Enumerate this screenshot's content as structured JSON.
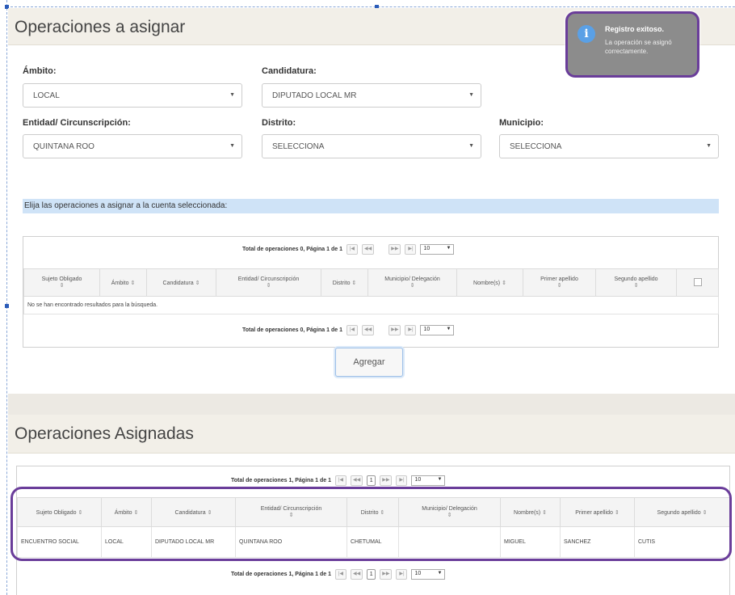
{
  "section1": {
    "title": "Operaciones a asignar"
  },
  "toast": {
    "title": "Registro exitoso.",
    "message": "La operación se asignó correctamente.",
    "icon": "info-icon"
  },
  "form": {
    "ambito": {
      "label": "Ámbito:",
      "value": "LOCAL"
    },
    "candidatura": {
      "label": "Candidatura:",
      "value": "DIPUTADO LOCAL MR"
    },
    "entidad": {
      "label": "Entidad/ Circunscripción:",
      "value": "QUINTANA ROO"
    },
    "distrito": {
      "label": "Distrito:",
      "value": "SELECCIONA"
    },
    "municipio": {
      "label": "Municipio:",
      "value": "SELECCIONA"
    }
  },
  "instructions": "Elija las operaciones a asignar a la cuenta seleccionada:",
  "table1": {
    "pager_text": "Total de operaciones 0, Página 1 de 1",
    "page_size": "10",
    "headers": [
      "Sujeto Obligado",
      "Ámbito",
      "Candidatura",
      "Entidad/ Circunscripción",
      "Distrito",
      "Municipio/ Delegación",
      "Nombre(s)",
      "Primer apellido",
      "Segundo apellido"
    ],
    "empty_message": "No se han encontrado resultados para la búsqueda."
  },
  "agregar_button": "Agregar",
  "section2": {
    "title": "Operaciones Asignadas"
  },
  "table2": {
    "pager_text": "Total de operaciones 1, Página 1 de 1",
    "current_page": "1",
    "page_size": "10",
    "headers": [
      "Sujeto Obligado",
      "Ámbito",
      "Candidatura",
      "Entidad/ Circunscripción",
      "Distrito",
      "Municipio/ Delegación",
      "Nombre(s)",
      "Primer apellido",
      "Segundo apellido"
    ],
    "rows": [
      [
        "ENCUENTRO SOCIAL",
        "LOCAL",
        "DIPUTADO LOCAL MR",
        "QUINTANA ROO",
        "CHETUMAL",
        "",
        "MIGUEL",
        "SANCHEZ",
        "CUTIS"
      ]
    ]
  },
  "colors": {
    "highlight": "#6a3d9a",
    "toast_bg": "#8c8c8c",
    "instructions_bg": "#cfe3f7",
    "header_bg": "#f2efe8"
  }
}
